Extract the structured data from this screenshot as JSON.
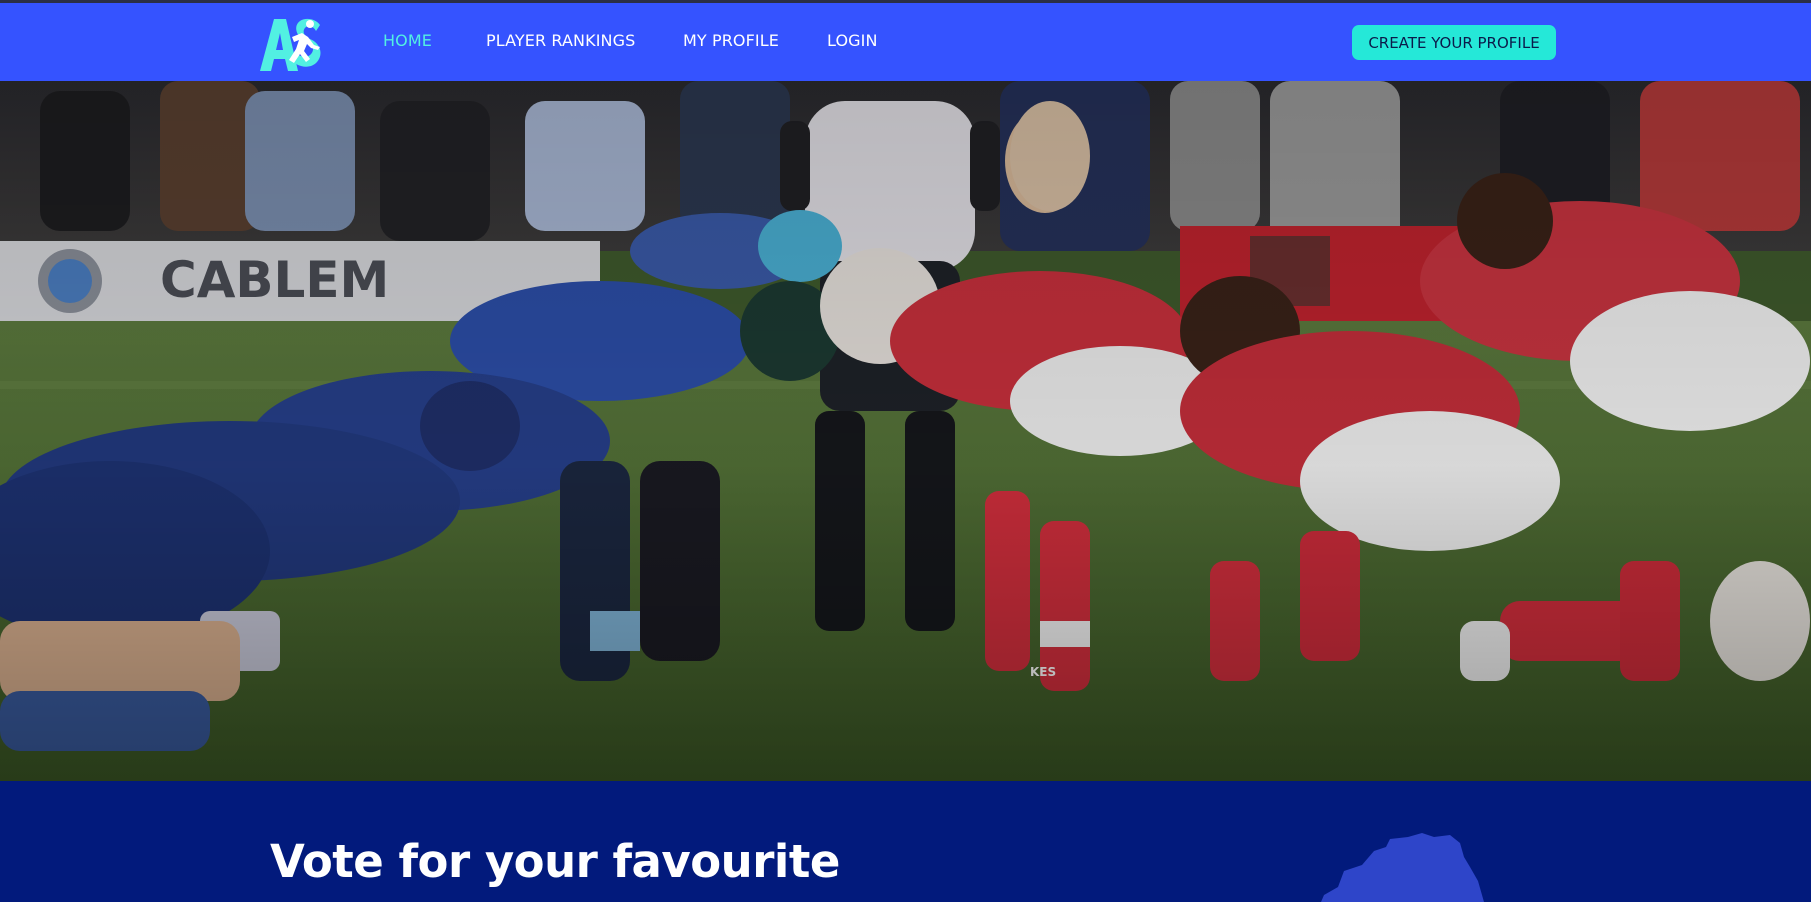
{
  "nav": {
    "logo_text": "AS",
    "links": [
      {
        "label": "HOME",
        "active": true
      },
      {
        "label": "PLAYER RANKINGS",
        "active": false
      },
      {
        "label": "MY PROFILE",
        "active": false
      },
      {
        "label": "LOGIN",
        "active": false
      }
    ],
    "cta_label": "CREATE YOUR PROFILE"
  },
  "hero": {
    "banner_text": "CABLEM",
    "sock_text": "KES"
  },
  "vote": {
    "title": "Vote for your favourite"
  },
  "colors": {
    "nav_bg": "#3553ff",
    "nav_active": "#52f0e2",
    "cta_bg": "#25e8d8",
    "section_bg": "#021a7c",
    "map_shape": "#2e45c9"
  }
}
